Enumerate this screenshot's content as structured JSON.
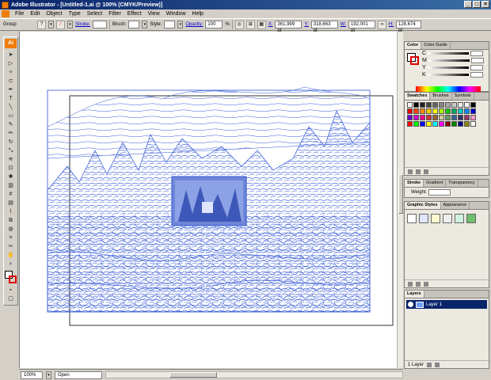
{
  "window": {
    "title": "Adobe Illustrator - [Untitled-1.ai @ 100% (CMYK/Preview)]"
  },
  "menu": [
    "File",
    "Edit",
    "Object",
    "Type",
    "Select",
    "Filter",
    "Effect",
    "View",
    "Window",
    "Help"
  ],
  "control_bar": {
    "selection": "Group",
    "stroke_label": "Stroke:",
    "brush_label": "Brush:",
    "style_label": "Style:",
    "opacity_label": "Opacity:",
    "opacity_value": "100",
    "opacity_unit": "%",
    "x_label": "X:",
    "x_value": "361,999 pt",
    "y_label": "Y:",
    "y_value": "318,663 pt",
    "w_label": "W:",
    "w_value": "192,001 pt",
    "h_label": "H:",
    "h_value": "128,674 pt"
  },
  "toolbox": {
    "logo": "Ai"
  },
  "status": {
    "zoom": "100%",
    "state": "Open"
  },
  "panels": {
    "color": {
      "tabs": [
        "Color",
        "Color Guide"
      ],
      "channels": [
        "C",
        "M",
        "Y",
        "K"
      ]
    },
    "swatches": {
      "tabs": [
        "Swatches",
        "Brushes",
        "Symbols"
      ]
    },
    "stroke": {
      "tabs": [
        "Stroke",
        "Gradient",
        "Transparency"
      ],
      "weight_label": "Weight:"
    },
    "graphic_styles": {
      "tabs": [
        "Graphic Styles",
        "Appearance"
      ]
    },
    "layers": {
      "tabs": [
        "Layers"
      ],
      "layer_name": "Layer 1",
      "footer": "1 Layer"
    }
  },
  "colors": {
    "trace": "#2f55d4",
    "accent": "#0a246a",
    "app_orange": "#f07d0a"
  }
}
